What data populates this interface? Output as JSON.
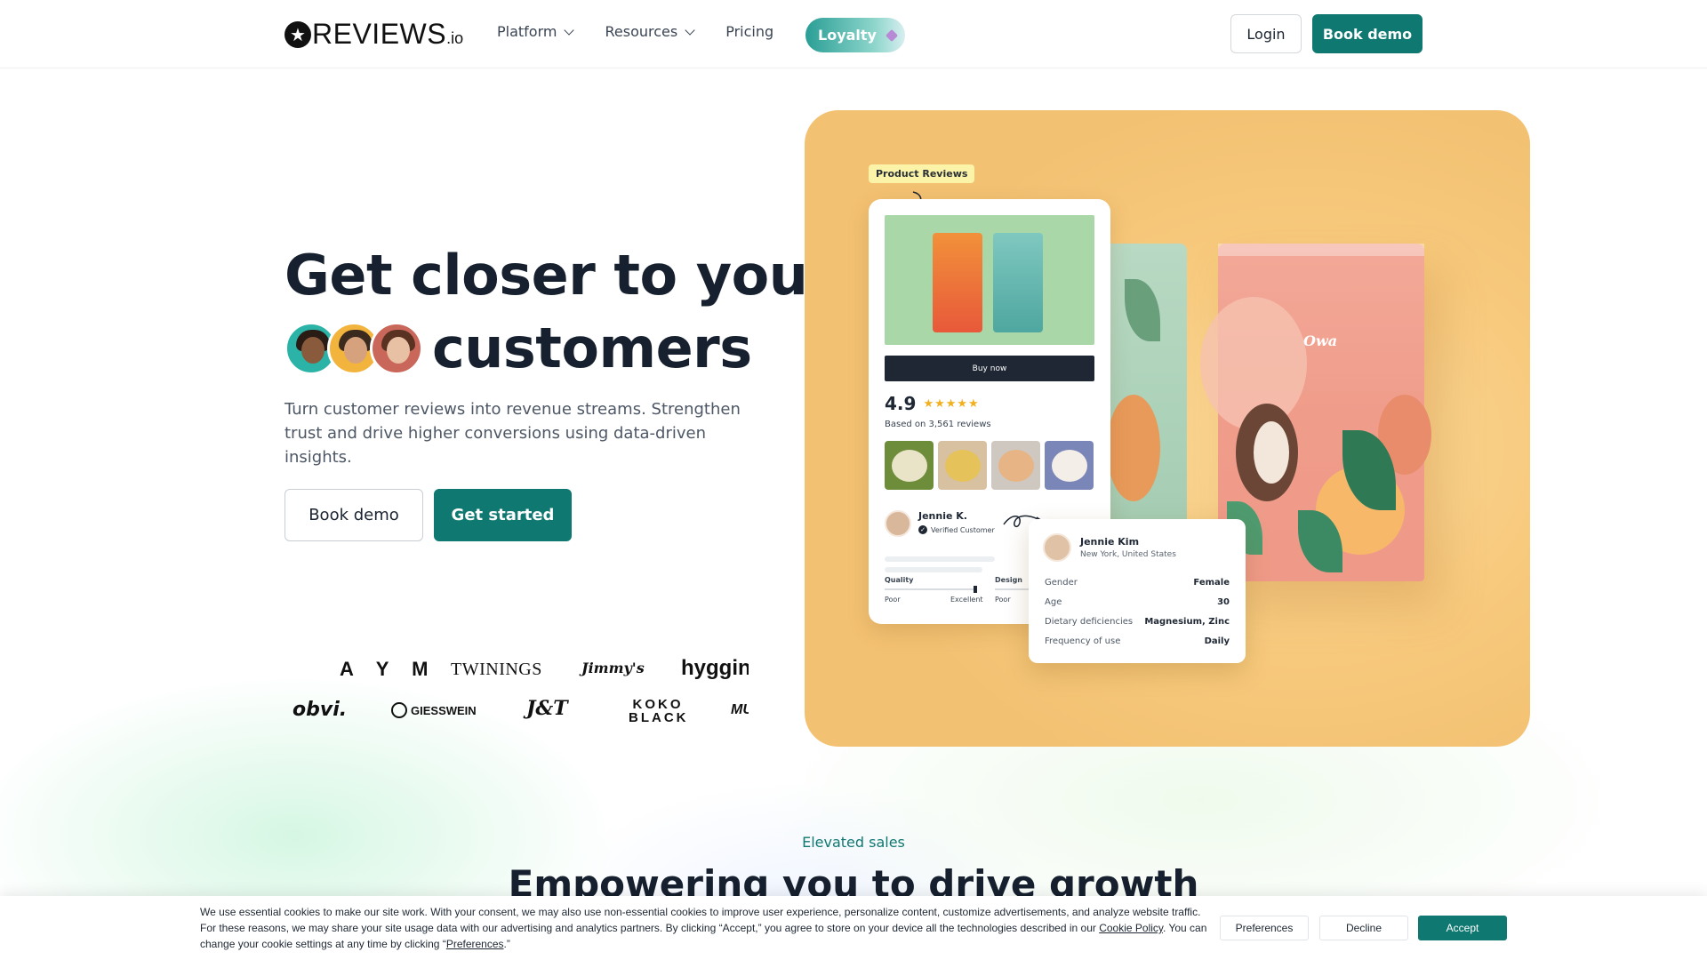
{
  "brand": {
    "name": "REVIEWS",
    "suffix": ".io",
    "star": "★"
  },
  "nav": {
    "links": [
      {
        "label": "Platform",
        "has_dropdown": true
      },
      {
        "label": "Resources",
        "has_dropdown": true
      },
      {
        "label": "Pricing",
        "has_dropdown": false
      }
    ],
    "loyalty_label": "Loyalty",
    "login_label": "Login",
    "book_demo_label": "Book demo"
  },
  "hero": {
    "title_line1": "Get closer to your",
    "title_line2": "customers",
    "subtitle": "Turn customer reviews into revenue streams. Strengthen trust and drive higher conversions using data-driven insights.",
    "book_demo_label": "Book demo",
    "get_started_label": "Get started"
  },
  "brands_row1": [
    "A Y M",
    "TWININGS",
    "Jimmy's",
    "hyggin"
  ],
  "brands_row2": [
    "obvi.",
    "GIESSWEIN",
    "J&T",
    "KOKO BLACK",
    "MU"
  ],
  "product_card": {
    "tag": "Product Reviews",
    "buy_label": "Buy now",
    "score": "4.9",
    "stars": "★★★★★",
    "based_on": "Based on 3,561 reviews",
    "reviewer_name": "Jennie K.",
    "reviewer_badge": "Verified Customer",
    "quality_label": "Quality",
    "design_label": "Design",
    "poor_label": "Poor",
    "excellent_label": "Excellent",
    "poor_label_2": "Poor"
  },
  "profile_card": {
    "name": "Jennie Kim",
    "location": "New York, United States",
    "rows": [
      {
        "key": "Gender",
        "value": "Female"
      },
      {
        "key": "Age",
        "value": "30"
      },
      {
        "key": "Dietary deficiencies",
        "value": "Magnesium, Zinc"
      },
      {
        "key": "Frequency of use",
        "value": "Daily"
      }
    ]
  },
  "section": {
    "eyebrow": "Elevated sales",
    "title": "Empowering you to drive growth"
  },
  "cookie": {
    "text_part1": "We use essential cookies to make our site work. With your consent, we may also use non-essential cookies to improve user experience, personalize content, customize advertisements, and analyze website traffic. For these reasons, we may share your site usage data with our advertising and analytics partners. By clicking “Accept,” you agree to store on your device all the technologies described in our ",
    "policy_link": "Cookie Policy",
    "text_part2": ". You can change your cookie settings at any time by clicking “",
    "preferences_link": "Preferences",
    "text_part3": ".”",
    "preferences_label": "Preferences",
    "decline_label": "Decline",
    "accept_label": "Accept"
  },
  "colors": {
    "brand_teal": "#0f7871",
    "hero_card_bg": "#f7c97c",
    "star_gold": "#f2b01e"
  },
  "icons": [
    "star-logo-icon",
    "chevron-down-icon",
    "gem-icon",
    "check-icon",
    "curl-arrow-icon"
  ]
}
